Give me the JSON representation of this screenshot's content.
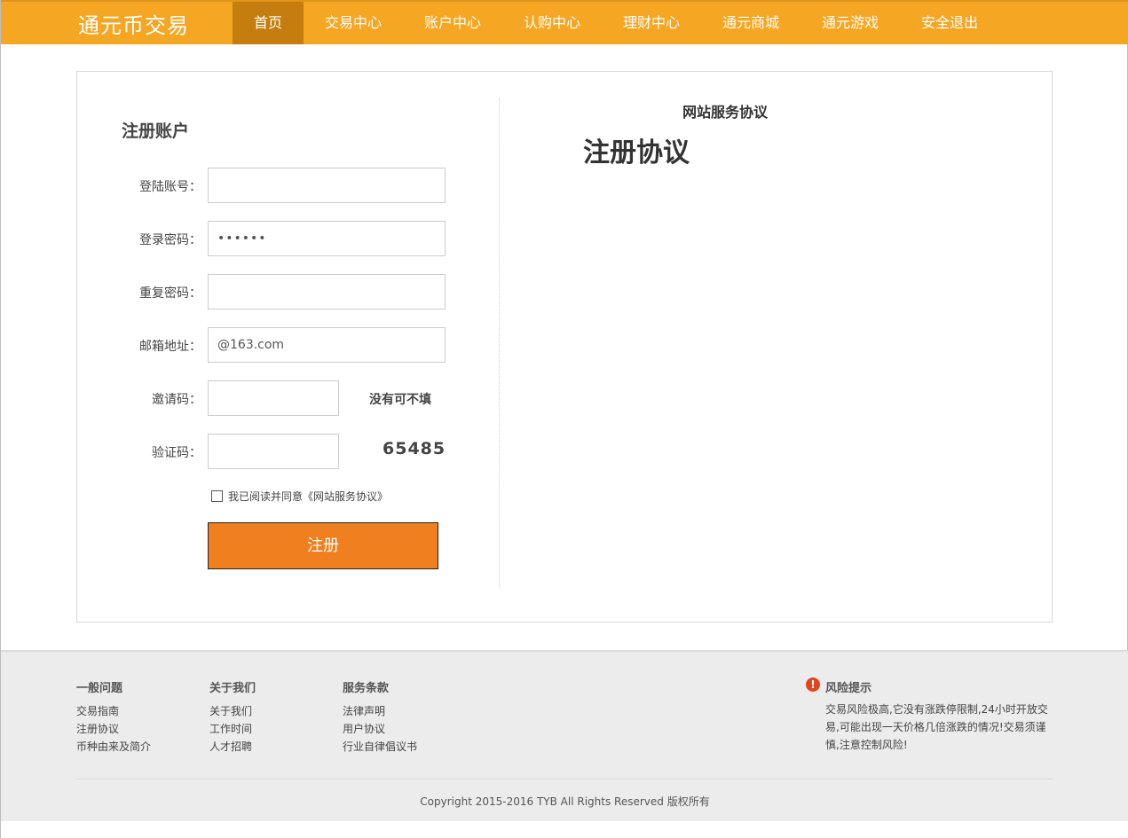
{
  "header": {
    "brand": "通元币交易",
    "nav": [
      {
        "label": "首页"
      },
      {
        "label": "交易中心"
      },
      {
        "label": "账户中心"
      },
      {
        "label": "认购中心"
      },
      {
        "label": "理财中心"
      },
      {
        "label": "通元商城"
      },
      {
        "label": "通元游戏"
      },
      {
        "label": "安全退出"
      }
    ],
    "active_index": 0
  },
  "register": {
    "title": "注册账户",
    "fields": {
      "account": {
        "label": "登陆账号：",
        "value": ""
      },
      "password": {
        "label": "登录密码：",
        "value": "••••••"
      },
      "repeat_password": {
        "label": "重复密码：",
        "value": ""
      },
      "email": {
        "label": "邮箱地址：",
        "value": "@163.com"
      },
      "invite": {
        "label": "邀请码：",
        "value": "",
        "hint": "没有可不填"
      },
      "captcha": {
        "label": "验证码：",
        "value": "",
        "code": "65485"
      }
    },
    "agree_text": "我已阅读并同意《网站服务协议》",
    "agree_checked": false,
    "submit_label": "注册"
  },
  "agreement": {
    "heading": "网站服务协议",
    "title": "注册协议"
  },
  "footer": {
    "columns": [
      {
        "title": "一般问题",
        "links": [
          "交易指南",
          "注册协议",
          "币种由来及简介"
        ]
      },
      {
        "title": "关于我们",
        "links": [
          "关于我们",
          "工作时间",
          "人才招聘"
        ]
      },
      {
        "title": "服务条款",
        "links": [
          "法律声明",
          "用户协议",
          "行业自律倡议书"
        ]
      }
    ],
    "risk": {
      "icon": "!",
      "title": "风险提示",
      "text": "交易风险极高,它没有涨跌停限制,24小时开放交易,可能出现一天价格几倍涨跌的情况!交易须谨慎,注意控制风险!"
    },
    "copyright": "Copyright 2015-2016 TYB All Rights Reserved 版权所有"
  },
  "colors": {
    "brand_orange": "#f5a623",
    "nav_active": "#c47d0e",
    "button_orange": "#ef7f1f",
    "risk_red": "#e0461a"
  }
}
